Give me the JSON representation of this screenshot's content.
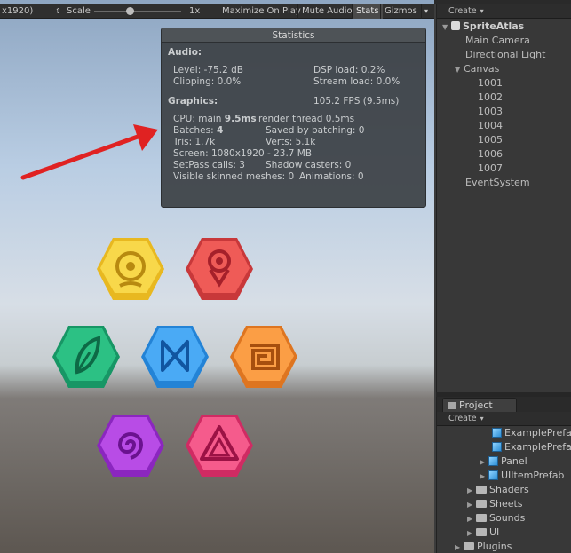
{
  "game_toolbar": {
    "resolution_label": "x1920)",
    "scale_label": "Scale",
    "scale_value": "1x",
    "maximize_on_play": "Maximize On Play",
    "mute_audio": "Mute Audio",
    "stats": "Stats",
    "gizmos": "Gizmos"
  },
  "statistics": {
    "title": "Statistics",
    "audio_heading": "Audio:",
    "level": "Level: -75.2 dB",
    "dsp_load": "DSP load: 0.2%",
    "clipping": "Clipping: 0.0%",
    "stream_load": "Stream load: 0.0%",
    "graphics_heading": "Graphics:",
    "fps": "105.2 FPS (9.5ms)",
    "cpu_prefix": "CPU: main ",
    "cpu_main": "9.5ms",
    "render_thread": "render thread 0.5ms",
    "batches_prefix": "Batches: ",
    "batches": "4",
    "saved_by_batching": "Saved by batching: 0",
    "tris": "Tris: 1.7k",
    "verts": "Verts: 5.1k",
    "screen": "Screen: 1080x1920 - 23.7 MB",
    "setpass": "SetPass calls: 3",
    "shadow_casters": "Shadow casters: 0",
    "skinned_meshes": "Visible skinned meshes: 0",
    "animations": "Animations: 0"
  },
  "game_icons": [
    {
      "name": "yellow-circle-icon",
      "color": "#f5cf3a"
    },
    {
      "name": "red-pin-icon",
      "color": "#e9514f"
    },
    {
      "name": "green-leaf-icon",
      "color": "#24b27a"
    },
    {
      "name": "blue-bowtie-icon",
      "color": "#3a9ff0"
    },
    {
      "name": "orange-spiral-square-icon",
      "color": "#f6913a"
    },
    {
      "name": "purple-swirl-icon",
      "color": "#b041de"
    },
    {
      "name": "pink-triangle-icon",
      "color": "#f0457e"
    }
  ],
  "hierarchy": {
    "create_label": "Create",
    "scene": "SpriteAtlas",
    "items": [
      "Main Camera",
      "Directional Light",
      "Canvas",
      "1001",
      "1002",
      "1003",
      "1004",
      "1005",
      "1006",
      "1007",
      "EventSystem"
    ]
  },
  "project": {
    "tab_label": "Project",
    "create_label": "Create",
    "items": [
      "ExamplePrefab",
      "ExamplePrefab",
      "Panel",
      "UIItemPrefab",
      "Shaders",
      "Sheets",
      "Sounds",
      "UI",
      "Plugins"
    ]
  },
  "colors": {
    "arrow": "#e02222",
    "panel_bg": "#383838"
  }
}
